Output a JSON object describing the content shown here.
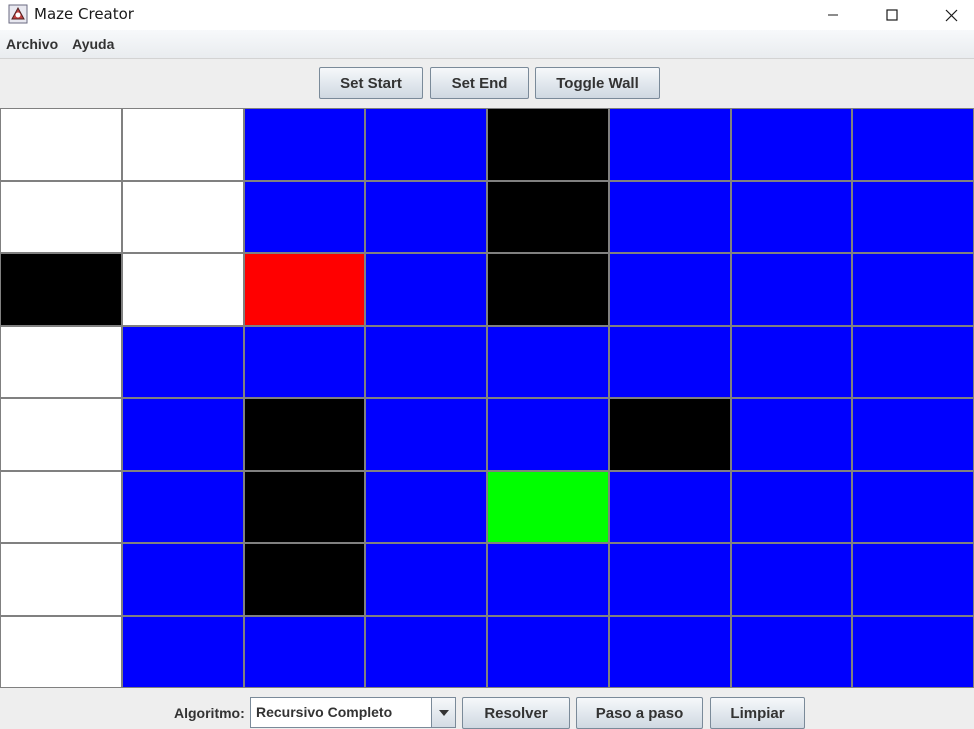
{
  "window": {
    "title": "Maze Creator"
  },
  "menu": {
    "items": [
      "Archivo",
      "Ayuda"
    ]
  },
  "toolbar": {
    "set_start_label": "Set Start",
    "set_end_label": "Set End",
    "toggle_wall_label": "Toggle Wall"
  },
  "maze": {
    "rows": 8,
    "cols": 8,
    "colors": {
      "W": "#ffffff",
      "B": "#0000ff",
      "K": "#000000",
      "R": "#ff0000",
      "G": "#00ff00"
    },
    "cells": [
      [
        "W",
        "W",
        "B",
        "B",
        "K",
        "B",
        "B",
        "B"
      ],
      [
        "W",
        "W",
        "B",
        "B",
        "K",
        "B",
        "B",
        "B"
      ],
      [
        "K",
        "W",
        "R",
        "B",
        "K",
        "B",
        "B",
        "B"
      ],
      [
        "W",
        "B",
        "B",
        "B",
        "B",
        "B",
        "B",
        "B"
      ],
      [
        "W",
        "B",
        "K",
        "B",
        "B",
        "K",
        "B",
        "B"
      ],
      [
        "W",
        "B",
        "K",
        "B",
        "G",
        "B",
        "B",
        "B"
      ],
      [
        "W",
        "B",
        "K",
        "B",
        "B",
        "B",
        "B",
        "B"
      ],
      [
        "W",
        "B",
        "B",
        "B",
        "B",
        "B",
        "B",
        "B"
      ]
    ]
  },
  "bottom": {
    "algorithm_label": "Algoritmo:",
    "algorithm_selected": "Recursivo Completo",
    "solve_label": "Resolver",
    "step_label": "Paso a paso",
    "clear_label": "Limpiar"
  }
}
